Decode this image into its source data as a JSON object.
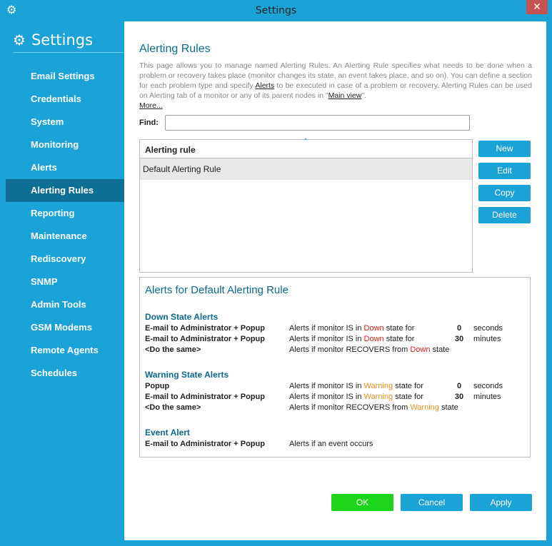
{
  "window": {
    "title": "Settings",
    "close": "✕"
  },
  "sidebar": {
    "heading": "Settings",
    "items": [
      {
        "label": "Email Settings"
      },
      {
        "label": "Credentials"
      },
      {
        "label": "System"
      },
      {
        "label": "Monitoring"
      },
      {
        "label": "Alerts"
      },
      {
        "label": "Alerting Rules",
        "active": true
      },
      {
        "label": "Reporting"
      },
      {
        "label": "Maintenance"
      },
      {
        "label": "Rediscovery"
      },
      {
        "label": "SNMP"
      },
      {
        "label": "Admin Tools"
      },
      {
        "label": "GSM Modems"
      },
      {
        "label": "Remote Agents"
      },
      {
        "label": "Schedules"
      }
    ]
  },
  "main": {
    "title": "Alerting Rules",
    "description_part1": "This page allows you to manage named Alerting Rules. An Alerting Rule specifies what needs to be done when a problem or recovery takes place (monitor changes its state, an event takes place, and so on). You can define a section for each problem type and specify ",
    "description_link1": "Alerts",
    "description_part2": " to be executed in case of a problem or recovery. Alerting Rules can be used on Alerting tab of a monitor or any of its parent nodes in \"",
    "description_link2": "Main view",
    "description_part3": "\".",
    "more_link": "More...",
    "find_label": "Find:",
    "find_value": "",
    "table": {
      "column": "Alerting rule",
      "rows": [
        "Default Alerting Rule"
      ]
    },
    "buttons": {
      "new": "New",
      "edit": "Edit",
      "copy": "Copy",
      "delete": "Delete"
    },
    "alerts_panel": {
      "title": "Alerts for Default Alerting Rule",
      "down": {
        "title": "Down State Alerts",
        "rows": [
          {
            "action": "E-mail to Administrator + Popup",
            "pre": "Alerts if monitor IS in ",
            "state": "Down",
            "post": " state for",
            "num": "0",
            "unit": "seconds"
          },
          {
            "action": "E-mail to Administrator + Popup",
            "pre": "Alerts if monitor IS in ",
            "state": "Down",
            "post": " state for",
            "num": "30",
            "unit": "minutes"
          },
          {
            "action": "<Do the same>",
            "pre": "Alerts if monitor RECOVERS from ",
            "state": "Down",
            "post": " state",
            "num": "",
            "unit": ""
          }
        ]
      },
      "warning": {
        "title": "Warning State Alerts",
        "rows": [
          {
            "action": "Popup",
            "pre": "Alerts if monitor IS in ",
            "state": "Warning",
            "post": " state for",
            "num": "0",
            "unit": "seconds"
          },
          {
            "action": "E-mail to Administrator + Popup",
            "pre": "Alerts if monitor IS in ",
            "state": "Warning",
            "post": " state for",
            "num": "30",
            "unit": "minutes"
          },
          {
            "action": "<Do the same>",
            "pre": "Alerts if monitor RECOVERS from ",
            "state": "Warning",
            "post": " state",
            "num": "",
            "unit": ""
          }
        ]
      },
      "event": {
        "title": "Event Alert",
        "rows": [
          {
            "action": "E-mail to Administrator + Popup",
            "pre": "Alerts if an event occurs",
            "state": "",
            "post": "",
            "num": "",
            "unit": ""
          }
        ]
      }
    },
    "footer": {
      "ok": "OK",
      "cancel": "Cancel",
      "apply": "Apply"
    }
  },
  "colors": {
    "accent": "#1ba3d8",
    "active_nav": "#0e6e95",
    "ok": "#1dd41a",
    "down": "#e02020",
    "warning": "#e89020"
  }
}
